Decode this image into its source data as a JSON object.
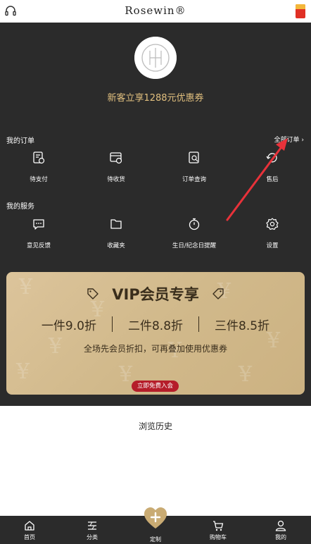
{
  "header": {
    "brand": "Rosewin®"
  },
  "profile": {
    "coupon_text": "新客立享1288元优惠券"
  },
  "orders": {
    "title": "我的订单",
    "all_label": "全部订单 ›",
    "items": [
      {
        "label": "待支付",
        "icon": "payment-icon"
      },
      {
        "label": "待收货",
        "icon": "receive-icon"
      },
      {
        "label": "订单查询",
        "icon": "order-search-icon"
      },
      {
        "label": "售后",
        "icon": "after-sales-icon"
      }
    ]
  },
  "services": {
    "title": "我的服务",
    "items": [
      {
        "label": "意见反馈",
        "icon": "feedback-icon"
      },
      {
        "label": "收藏夹",
        "icon": "folder-icon"
      },
      {
        "label": "生日/纪念日提醒",
        "icon": "timer-icon"
      },
      {
        "label": "设置",
        "icon": "gear-icon"
      }
    ]
  },
  "vip": {
    "title": "VIP会员专享",
    "offers": [
      "一件9.0折",
      "二件8.8折",
      "三件8.5折"
    ],
    "subtitle": "全场先会员折扣，可再叠加使用优惠券",
    "join_label": "立即免费入会"
  },
  "history": {
    "title": "浏览历史"
  },
  "bottom_nav": [
    {
      "label": "首页",
      "icon": "home-icon"
    },
    {
      "label": "分类",
      "icon": "category-icon"
    },
    {
      "label": "定制",
      "icon": "heart-plus-icon"
    },
    {
      "label": "购物车",
      "icon": "cart-icon"
    },
    {
      "label": "我的",
      "icon": "profile-icon"
    }
  ],
  "colors": {
    "dark_bg": "#2b2b2b",
    "gold": "#e2c07f",
    "vip_bg": "#d4bc8f",
    "join_red": "#b51d2a",
    "arrow_red": "#e8323a"
  }
}
